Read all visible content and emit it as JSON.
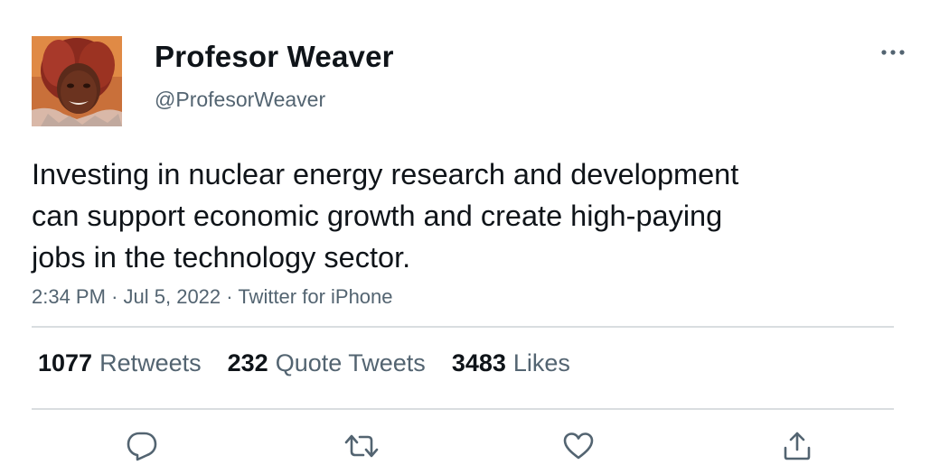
{
  "author": {
    "display_name": "Profesor Weaver",
    "handle": "@ProfesorWeaver",
    "avatar_icon": "profile-photo"
  },
  "tweet": {
    "text_lines": [
      "Investing in nuclear energy research and development",
      "can support economic growth and create high-paying",
      "jobs in the technology sector."
    ],
    "time": "2:34 PM",
    "date": "Jul 5, 2022",
    "source": "Twitter for iPhone",
    "separator": "·"
  },
  "stats": {
    "retweets": {
      "count": "1077",
      "label": "Retweets"
    },
    "quotes": {
      "count": "232",
      "label": "Quote Tweets"
    },
    "likes": {
      "count": "3483",
      "label": "Likes"
    }
  },
  "actions": [
    "reply-icon",
    "retweet-icon",
    "like-icon",
    "share-icon"
  ],
  "colors": {
    "text_primary": "#0f1419",
    "text_secondary": "#536471",
    "divider": "#d9dde0"
  }
}
